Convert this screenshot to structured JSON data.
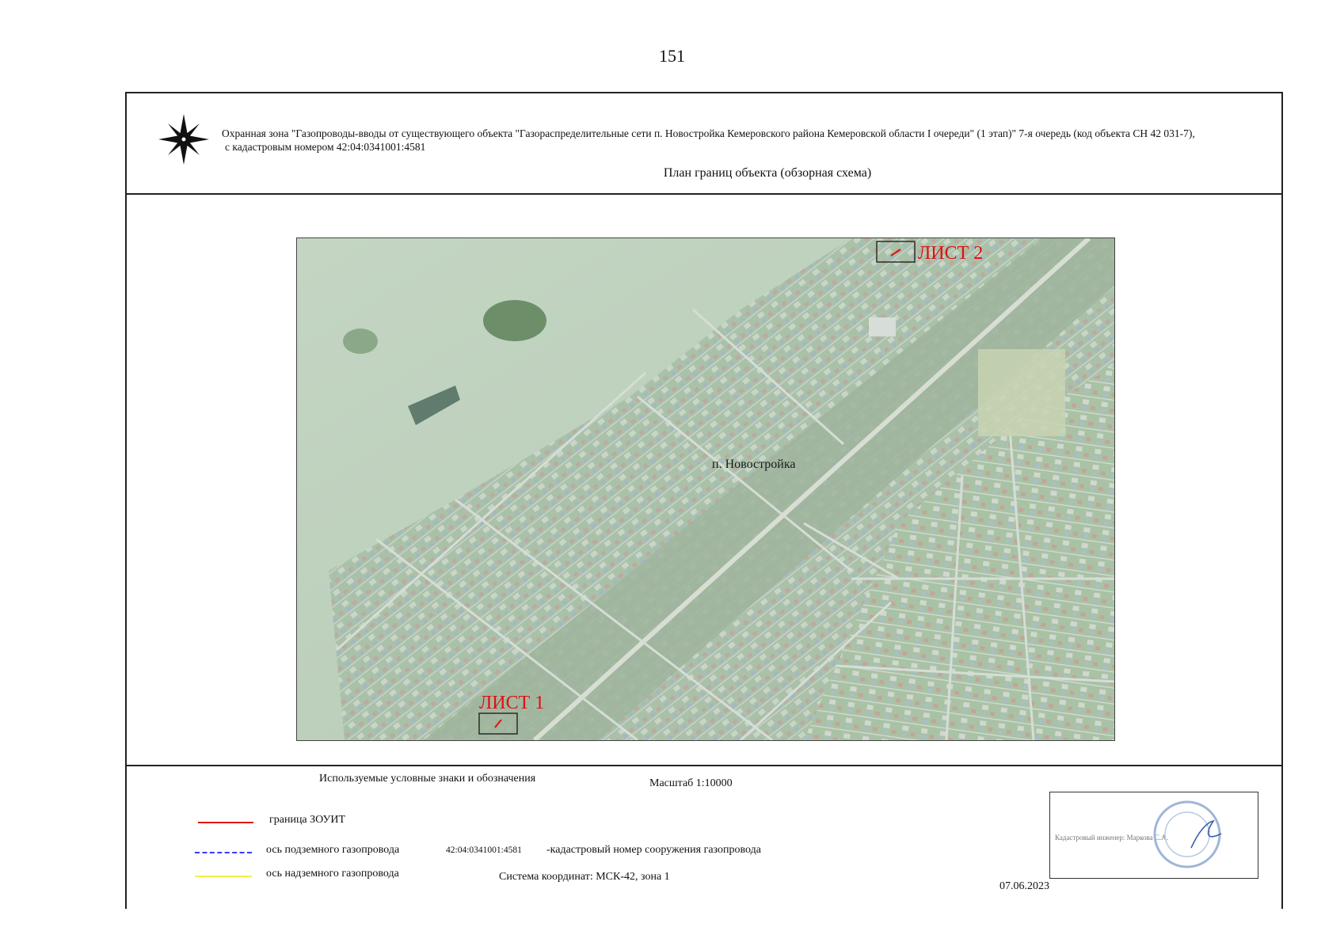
{
  "page_number": "151",
  "title": {
    "line1": "Охранная зона \"Газопроводы-вводы от существующего объекта \"Газораспределительные сети п. Новостройка Кемеровского района Кемеровской области I очереди\" (1 этап)\" 7-я очередь (код объекта СН 42 031-7),",
    "line2": "с кадастровым номером 42:04:0341001:4581"
  },
  "subtitle": "План границ объекта (обзорная схема)",
  "map": {
    "place_label": "п. Новостройка",
    "sheet1_label": "ЛИСТ 1",
    "sheet2_label": "ЛИСТ 2",
    "boundary_color": "#e01010"
  },
  "legend": {
    "title": "Используемые условные  знаки и обозначения",
    "scale": "Масштаб 1:10000",
    "items": [
      {
        "label": "граница ЗОУИТ",
        "color": "#e01010",
        "style": "solid"
      },
      {
        "label": "ось подземного газопровода",
        "color": "#3a3aff",
        "style": "dashed"
      },
      {
        "label": "ось надземного газопровода",
        "color": "#f2ef4a",
        "style": "solid"
      }
    ],
    "cadastral_sample": "42:04:0341001:4581",
    "cadastral_desc": "-кадастровый  номер сооружения газопровода",
    "coordinate_system": "Система координат: МСК-42, зона 1"
  },
  "stamp": {
    "label": "Кадастровый инженер: Маркова С.А."
  },
  "date": "07.06.2023"
}
